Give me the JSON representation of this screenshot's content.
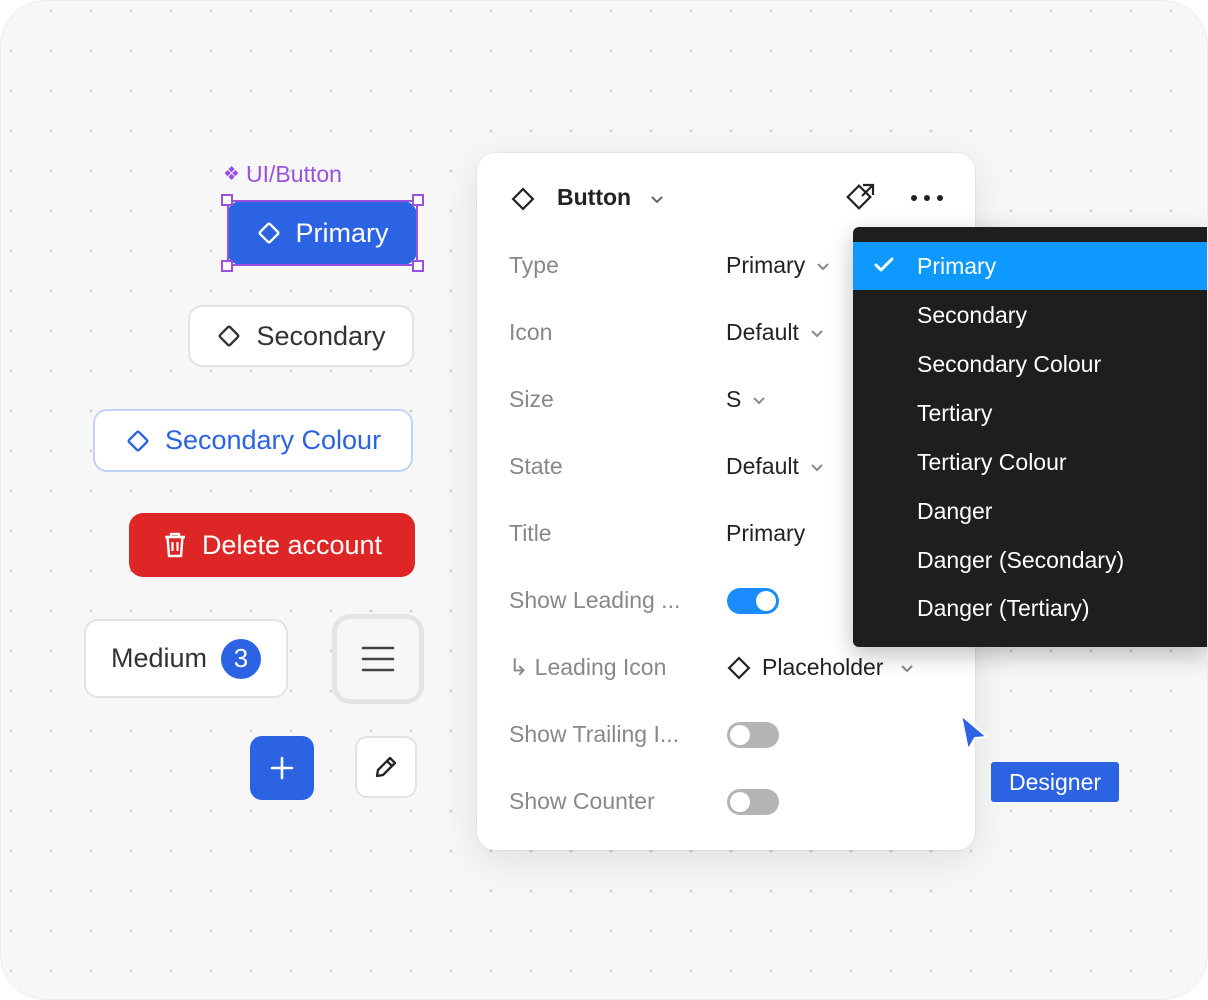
{
  "component_label": "UI/Button",
  "buttons": {
    "primary": "Primary",
    "secondary": "Secondary",
    "secondary_colour": "Secondary Colour",
    "danger": "Delete account",
    "medium": "Medium",
    "medium_count": "3"
  },
  "panel": {
    "title": "Button",
    "properties": [
      {
        "label": "Type",
        "value": "Primary"
      },
      {
        "label": "Icon",
        "value": "Default"
      },
      {
        "label": "Size",
        "value": "S"
      },
      {
        "label": "State",
        "value": "Default"
      },
      {
        "label": "Title",
        "value": "Primary"
      },
      {
        "label": "Show Leading ...",
        "toggle": "on"
      },
      {
        "label": "↳ Leading Icon",
        "value": "Placeholder"
      },
      {
        "label": "Show Trailing I...",
        "toggle": "off"
      },
      {
        "label": "Show Counter",
        "toggle": "off"
      }
    ]
  },
  "dropdown": {
    "options": [
      "Primary",
      "Secondary",
      "Secondary Colour",
      "Tertiary",
      "Tertiary Colour",
      "Danger",
      "Danger (Secondary)",
      "Danger (Tertiary)"
    ],
    "selected": "Primary"
  },
  "cursor": {
    "label": "Designer"
  },
  "colors": {
    "accent": "#2b63e3",
    "selection": "#9b51e0",
    "danger": "#de2626",
    "dropdown_active": "#0d99ff",
    "toggle_on": "#1a8cff"
  },
  "icons": [
    "component-icon",
    "diamond-icon",
    "trash-icon",
    "hamburger-icon",
    "plus-icon",
    "pencil-icon",
    "chevron-down-icon",
    "detach-icon",
    "more-icon",
    "check-icon",
    "cursor-arrow-icon"
  ]
}
